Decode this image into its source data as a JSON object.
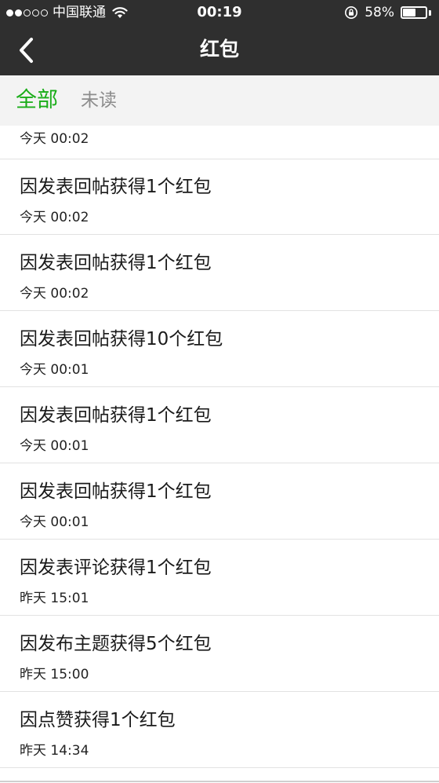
{
  "status_bar": {
    "carrier": "中国联通",
    "time": "00:19",
    "battery": "58%",
    "battery_level": 0.58,
    "signal_bars_filled": 2,
    "signal_bars_total": 5
  },
  "nav": {
    "title": "红包",
    "back_icon": "chevron-left-icon"
  },
  "tabs": [
    {
      "label": "全部",
      "active": true
    },
    {
      "label": "未读",
      "active": false
    }
  ],
  "colors": {
    "header_bg": "#2f2f2f",
    "tab_active": "#1aad19",
    "tab_inactive": "#8c8c8c",
    "tab_bar_bg": "#f3f3f3"
  },
  "partial_item": {
    "time": "今天 00:02"
  },
  "items": [
    {
      "title": "因发表回帖获得1个红包",
      "time": "今天 00:02"
    },
    {
      "title": "因发表回帖获得1个红包",
      "time": "今天 00:02"
    },
    {
      "title": "因发表回帖获得10个红包",
      "time": "今天 00:01"
    },
    {
      "title": "因发表回帖获得1个红包",
      "time": "今天 00:01"
    },
    {
      "title": "因发表回帖获得1个红包",
      "time": "今天 00:01"
    },
    {
      "title": "因发表评论获得1个红包",
      "time": "昨天 15:01"
    },
    {
      "title": "因发布主题获得5个红包",
      "time": "昨天 15:00"
    },
    {
      "title": "因点赞获得1个红包",
      "time": "昨天 14:34"
    }
  ]
}
